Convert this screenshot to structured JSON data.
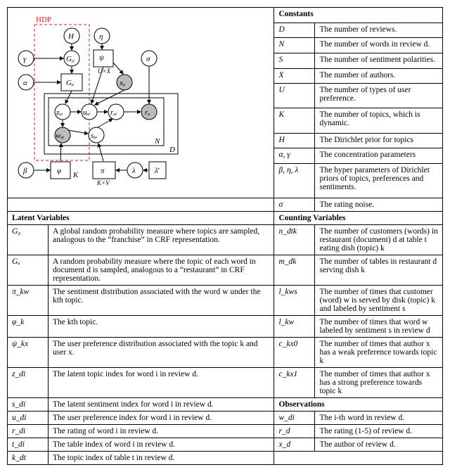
{
  "diagram": {
    "hdp_label": "HDP",
    "nodes": {
      "H": "H",
      "eta": "η",
      "G0": "G₀",
      "psi": "ψ",
      "psi_sub": "U×X",
      "sigma": "σ",
      "gamma": "γ",
      "alpha": "α",
      "Gd": "Gₐ",
      "xd": "xₐ",
      "zdi": "zₐᵢ",
      "udi": "uₐᵢ",
      "rdi": "rₐᵢ",
      "rd": "rₐ",
      "wdi": "wₐᵢ",
      "sdi": "sₐᵢ",
      "beta": "β",
      "phi": "φ",
      "K": "K",
      "pi": "π",
      "pi_sub": "K×V",
      "lambda": "λ",
      "N": "N",
      "D": "D",
      "lambda_vec": "λ̄"
    }
  },
  "constants": {
    "title": "Constants",
    "rows": [
      {
        "sym": "D",
        "desc": "The number of reviews."
      },
      {
        "sym": "N",
        "desc": "The number of words in review d."
      },
      {
        "sym": "S",
        "desc": "The number of sentiment polarities."
      },
      {
        "sym": "X",
        "desc": "The number of authors."
      },
      {
        "sym": "U",
        "desc": "The number of types of user preference."
      },
      {
        "sym": "K",
        "desc": "The number of topics, which is dynamic."
      },
      {
        "sym": "H",
        "desc": "The Dirichlet prior for topics"
      },
      {
        "sym": "α, γ",
        "desc": "The concentration parameters"
      },
      {
        "sym": "β, η, λ",
        "desc": "The hyper parameters of Dirichlet priors of topics, preferences and sentiments."
      },
      {
        "sym": "σ",
        "desc": "The rating noise."
      }
    ]
  },
  "latent": {
    "title": "Latent Variables",
    "rows": [
      {
        "sym": "G₀",
        "desc": "A global random probability measure where topics are sampled, analogous to the “franchise” in CRF representation."
      },
      {
        "sym": "Gₐ",
        "desc": "A random probability measure where the topic of each word in document d is sampled, analogous to a “restaurant” in CRF representation."
      },
      {
        "sym": "π_kw",
        "desc": "The sentiment distribution associated with the word w under the kth topic."
      },
      {
        "sym": "φ_k",
        "desc": "The kth topic."
      },
      {
        "sym": "ψ_kx",
        "desc": "The user preference distribution associated with the topic k and user x."
      },
      {
        "sym": "z_di",
        "desc": "The latent topic index for word i in review d."
      },
      {
        "sym": "s_di",
        "desc": "The latent sentiment index for word i in review d."
      },
      {
        "sym": "u_di",
        "desc": "The user preference index for word i in review d."
      },
      {
        "sym": "r_di",
        "desc": "The rating of word i in review d."
      },
      {
        "sym": "t_di",
        "desc": "The table index of word i in review d."
      },
      {
        "sym": "k_dt",
        "desc": "The topic index of table t in review d."
      }
    ]
  },
  "counting": {
    "title": "Counting Variables",
    "rows": [
      {
        "sym": "n_dtk",
        "desc": "The number of customers (words) in restaurant (document) d at table t eating dish (topic) k"
      },
      {
        "sym": "m_dk",
        "desc": "The number of tables in restaurant d serving dish k"
      },
      {
        "sym": "l_kws",
        "desc": "The number of times that customer (word) w is served by disk (topic) k and labeled by sentiment s"
      },
      {
        "sym": "l_kw",
        "desc": "The number of times that word w labeled by sentiment s in review d"
      },
      {
        "sym": "c_kx0",
        "desc": "The number of times that author x has a weak preference towards topic k"
      },
      {
        "sym": "c_kx1",
        "desc": "The number of times that author x has a strong preference towards topic k"
      }
    ]
  },
  "obs": {
    "title": "Observations",
    "rows": [
      {
        "sym": "w_di",
        "desc": "The i-th word in review d."
      },
      {
        "sym": "r_d",
        "desc": "The rating (1-5) of review d."
      },
      {
        "sym": "x_d",
        "desc": "The author of review d."
      }
    ]
  }
}
